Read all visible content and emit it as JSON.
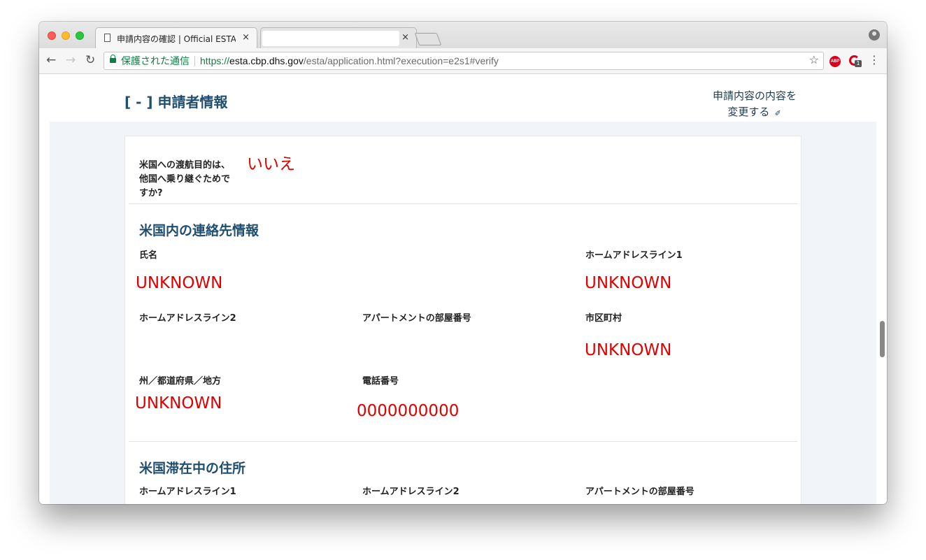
{
  "browser": {
    "active_tab_title": "申請内容の確認 | Official ESTA Application Website, U.S. Customs and Border Protection",
    "secure_label": "保護された通信",
    "url_protocol": "https://",
    "url_host": "esta.cbp.dhs.gov",
    "url_path": "/esta/application.html?execution=e2s1#verify",
    "abp_label": "ABP",
    "ext_badge": "1",
    "close_glyph": "×"
  },
  "section": {
    "toggle": "[ - ] 申請者情報",
    "edit_line1": "申請内容の内容を",
    "edit_line2": "変更する"
  },
  "transit": {
    "question": "米国への渡航目的は、他国へ乗り継ぐためですか?",
    "answer": "いいえ"
  },
  "contact": {
    "title": "米国内の連絡先情報",
    "name_label": "氏名",
    "name_value": "UNKNOWN",
    "addr1_label": "ホームアドレスライン1",
    "addr1_value": "UNKNOWN",
    "addr2_label": "ホームアドレスライン2",
    "apt_label": "アパートメントの部屋番号",
    "city_label": "市区町村",
    "city_value": "UNKNOWN",
    "state_label": "州／都道府県／地方",
    "state_value": "UNKNOWN",
    "phone_label": "電話番号",
    "phone_value": "0000000000"
  },
  "stay": {
    "title": "米国滞在中の住所",
    "addr1_label": "ホームアドレスライン1",
    "addr2_label": "ホームアドレスライン2",
    "apt_label": "アパートメントの部屋番号"
  }
}
